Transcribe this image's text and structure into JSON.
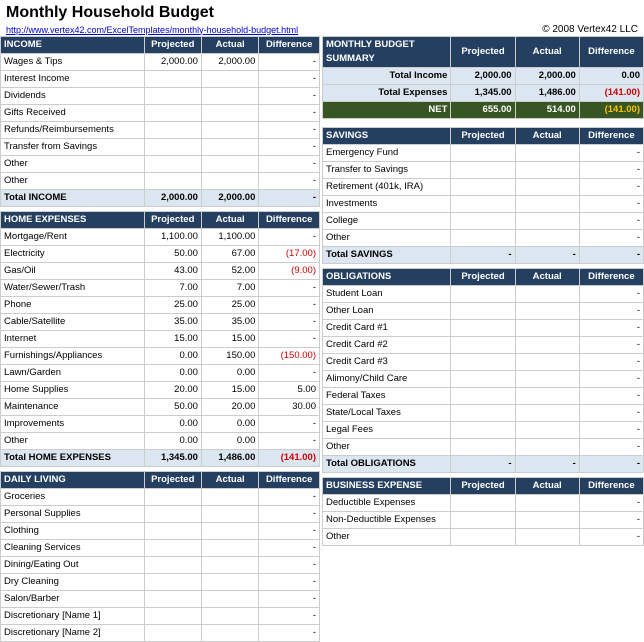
{
  "title": "Monthly Household Budget",
  "link": "http://www.vertex42.com/ExcelTemplates/monthly-household-budget.html",
  "copyright": "© 2008 Vertex42 LLC",
  "income_section": {
    "header": "INCOME",
    "col_projected": "Projected",
    "col_actual": "Actual",
    "col_difference": "Difference",
    "rows": [
      {
        "label": "Wages & Tips",
        "projected": "2,000.00",
        "actual": "2,000.00",
        "difference": "-"
      },
      {
        "label": "Interest Income",
        "projected": "",
        "actual": "",
        "difference": "-"
      },
      {
        "label": "Dividends",
        "projected": "",
        "actual": "",
        "difference": "-"
      },
      {
        "label": "Gifts Received",
        "projected": "",
        "actual": "",
        "difference": "-"
      },
      {
        "label": "Refunds/Reimbursements",
        "projected": "",
        "actual": "",
        "difference": "-"
      },
      {
        "label": "Transfer from Savings",
        "projected": "",
        "actual": "",
        "difference": "-"
      },
      {
        "label": "Other",
        "projected": "",
        "actual": "",
        "difference": "-"
      },
      {
        "label": "Other",
        "projected": "",
        "actual": "",
        "difference": "-"
      }
    ],
    "total_label": "Total INCOME",
    "total_projected": "2,000.00",
    "total_actual": "2,000.00",
    "total_difference": "-"
  },
  "home_section": {
    "header": "HOME EXPENSES",
    "col_projected": "Projected",
    "col_actual": "Actual",
    "col_difference": "Difference",
    "rows": [
      {
        "label": "Mortgage/Rent",
        "projected": "1,100.00",
        "actual": "1,100.00",
        "difference": "-"
      },
      {
        "label": "Electricity",
        "projected": "50.00",
        "actual": "67.00",
        "difference": "(17.00)",
        "red": true
      },
      {
        "label": "Gas/Oil",
        "projected": "43.00",
        "actual": "52.00",
        "difference": "(9.00)",
        "red": true
      },
      {
        "label": "Water/Sewer/Trash",
        "projected": "7.00",
        "actual": "7.00",
        "difference": "-"
      },
      {
        "label": "Phone",
        "projected": "25.00",
        "actual": "25.00",
        "difference": "-"
      },
      {
        "label": "Cable/Satellite",
        "projected": "35.00",
        "actual": "35.00",
        "difference": "-"
      },
      {
        "label": "Internet",
        "projected": "15.00",
        "actual": "15.00",
        "difference": "-"
      },
      {
        "label": "Furnishings/Appliances",
        "projected": "0.00",
        "actual": "150.00",
        "difference": "(150.00)",
        "red": true
      },
      {
        "label": "Lawn/Garden",
        "projected": "0.00",
        "actual": "0.00",
        "difference": "-"
      },
      {
        "label": "Home Supplies",
        "projected": "20.00",
        "actual": "15.00",
        "difference": "5.00"
      },
      {
        "label": "Maintenance",
        "projected": "50.00",
        "actual": "20.00",
        "difference": "30.00"
      },
      {
        "label": "Improvements",
        "projected": "0.00",
        "actual": "0.00",
        "difference": "-"
      },
      {
        "label": "Other",
        "projected": "0.00",
        "actual": "0.00",
        "difference": "-"
      }
    ],
    "total_label": "Total HOME EXPENSES",
    "total_projected": "1,345.00",
    "total_actual": "1,486.00",
    "total_difference": "(141.00)",
    "total_red": true
  },
  "daily_section": {
    "header": "DAILY LIVING",
    "col_projected": "Projected",
    "col_actual": "Actual",
    "col_difference": "Difference",
    "rows": [
      {
        "label": "Groceries",
        "projected": "",
        "actual": "",
        "difference": "-"
      },
      {
        "label": "Personal Supplies",
        "projected": "",
        "actual": "",
        "difference": "-"
      },
      {
        "label": "Clothing",
        "projected": "",
        "actual": "",
        "difference": "-"
      },
      {
        "label": "Cleaning Services",
        "projected": "",
        "actual": "",
        "difference": "-"
      },
      {
        "label": "Dining/Eating Out",
        "projected": "",
        "actual": "",
        "difference": "-"
      },
      {
        "label": "Dry Cleaning",
        "projected": "",
        "actual": "",
        "difference": "-"
      },
      {
        "label": "Salon/Barber",
        "projected": "",
        "actual": "",
        "difference": "-"
      },
      {
        "label": "Discretionary [Name 1]",
        "projected": "",
        "actual": "",
        "difference": "-"
      },
      {
        "label": "Discretionary [Name 2]",
        "projected": "",
        "actual": "",
        "difference": "-"
      }
    ]
  },
  "summary_section": {
    "header": "MONTHLY BUDGET SUMMARY",
    "col_projected": "Projected",
    "col_actual": "Actual",
    "col_difference": "Difference",
    "rows": [
      {
        "label": "Total Income",
        "projected": "2,000.00",
        "actual": "2,000.00",
        "difference": "0.00"
      },
      {
        "label": "Total Expenses",
        "projected": "1,345.00",
        "actual": "1,486.00",
        "difference": "(141.00)",
        "red": true
      }
    ],
    "net_label": "NET",
    "net_projected": "655.00",
    "net_actual": "514.00",
    "net_difference": "(141.00)"
  },
  "savings_section": {
    "header": "SAVINGS",
    "col_projected": "Projected",
    "col_actual": "Actual",
    "col_difference": "Difference",
    "rows": [
      {
        "label": "Emergency Fund",
        "projected": "",
        "actual": "",
        "difference": "-"
      },
      {
        "label": "Transfer to Savings",
        "projected": "",
        "actual": "",
        "difference": "-"
      },
      {
        "label": "Retirement (401k, IRA)",
        "projected": "",
        "actual": "",
        "difference": "-"
      },
      {
        "label": "Investments",
        "projected": "",
        "actual": "",
        "difference": "-"
      },
      {
        "label": "College",
        "projected": "",
        "actual": "",
        "difference": "-"
      },
      {
        "label": "Other",
        "projected": "",
        "actual": "",
        "difference": "-"
      }
    ],
    "total_label": "Total SAVINGS",
    "total_projected": "-",
    "total_actual": "-",
    "total_difference": "-"
  },
  "obligations_section": {
    "header": "OBLIGATIONS",
    "col_projected": "Projected",
    "col_actual": "Actual",
    "col_difference": "Difference",
    "rows": [
      {
        "label": "Student Loan",
        "projected": "",
        "actual": "",
        "difference": "-"
      },
      {
        "label": "Other Loan",
        "projected": "",
        "actual": "",
        "difference": "-"
      },
      {
        "label": "Credit Card #1",
        "projected": "",
        "actual": "",
        "difference": "-"
      },
      {
        "label": "Credit Card #2",
        "projected": "",
        "actual": "",
        "difference": "-"
      },
      {
        "label": "Credit Card #3",
        "projected": "",
        "actual": "",
        "difference": "-"
      },
      {
        "label": "Alimony/Child Care",
        "projected": "",
        "actual": "",
        "difference": "-"
      },
      {
        "label": "Federal Taxes",
        "projected": "",
        "actual": "",
        "difference": "-"
      },
      {
        "label": "State/Local Taxes",
        "projected": "",
        "actual": "",
        "difference": "-"
      },
      {
        "label": "Legal Fees",
        "projected": "",
        "actual": "",
        "difference": "-"
      },
      {
        "label": "Other",
        "projected": "",
        "actual": "",
        "difference": "-"
      }
    ],
    "total_label": "Total OBLIGATIONS",
    "total_projected": "-",
    "total_actual": "-",
    "total_difference": "-"
  },
  "business_section": {
    "header": "BUSINESS EXPENSE",
    "col_projected": "Projected",
    "col_actual": "Actual",
    "col_difference": "Difference",
    "rows": [
      {
        "label": "Deductible Expenses",
        "projected": "",
        "actual": "",
        "difference": "-"
      },
      {
        "label": "Non-Deductible Expenses",
        "projected": "",
        "actual": "",
        "difference": "-"
      },
      {
        "label": "Other",
        "projected": "",
        "actual": "",
        "difference": "-"
      }
    ]
  }
}
